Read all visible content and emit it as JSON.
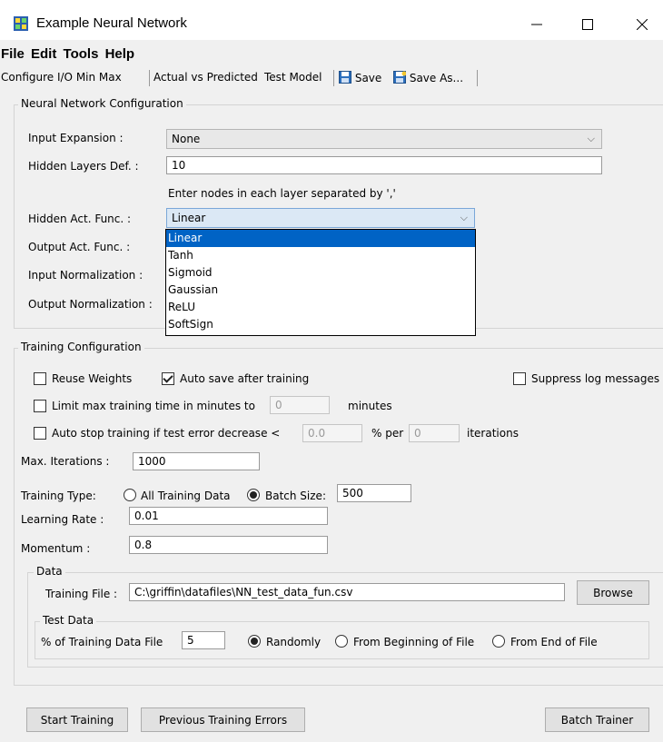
{
  "window": {
    "title": "Example Neural Network",
    "minimize_icon": "minimize-icon",
    "maximize_icon": "maximize-icon",
    "close_icon": "close-icon"
  },
  "menu": [
    "File",
    "Edit",
    "Tools",
    "Help"
  ],
  "toolbar": {
    "configure": "Configure I/O Min Max",
    "actual_vs_predicted": "Actual vs Predicted",
    "test_model": "Test Model",
    "save": "Save",
    "save_as": "Save As..."
  },
  "nn_config": {
    "title": "Neural Network Configuration",
    "input_expansion": {
      "label": "Input Expansion :",
      "value": "None"
    },
    "hidden_layers": {
      "label": "Hidden Layers Def. :",
      "value": "10",
      "hint": "Enter nodes in each layer separated by ','"
    },
    "hidden_act": {
      "label": "Hidden Act. Func. :",
      "value": "Linear",
      "options": [
        "Linear",
        "Tanh",
        "Sigmoid",
        "Gaussian",
        "ReLU",
        "SoftSign"
      ]
    },
    "output_act": {
      "label": "Output Act. Func. :"
    },
    "input_norm": {
      "label": "Input Normalization :"
    },
    "output_norm": {
      "label": "Output Normalization :"
    }
  },
  "training": {
    "title": "Training Configuration",
    "reuse_weights": {
      "label": "Reuse Weights",
      "checked": false
    },
    "auto_save": {
      "label": "Auto save after training",
      "checked": true
    },
    "suppress_log": {
      "label": "Suppress log messages",
      "checked": false
    },
    "limit_time": {
      "label": "Limit max training time in minutes to",
      "value": "0",
      "unit": "minutes",
      "checked": false
    },
    "auto_stop": {
      "label": "Auto stop training if test error decrease <",
      "value": "0.0",
      "per_label": "% per",
      "iter_value": "0",
      "iter_label": "iterations",
      "checked": false
    },
    "max_iterations": {
      "label": "Max. Iterations :",
      "value": "1000"
    },
    "training_type": {
      "label": "Training Type:",
      "all_label": "All Training Data",
      "batch_label": "Batch Size:",
      "batch_value": "500",
      "selected": "batch"
    },
    "learning_rate": {
      "label": "Learning Rate :",
      "value": "0.01"
    },
    "momentum": {
      "label": "Momentum :",
      "value": "0.8"
    },
    "data": {
      "title": "Data",
      "training_file_label": "Training File :",
      "training_file_value": "C:\\griffin\\datafiles\\NN_test_data_fun.csv",
      "browse": "Browse",
      "test_data": {
        "title": "Test Data",
        "pct_label": "% of Training Data File",
        "pct_value": "5",
        "randomly": "Randomly",
        "from_beginning": "From Beginning of File",
        "from_end": "From End of File",
        "selected": "randomly"
      }
    }
  },
  "buttons": {
    "start": "Start Training",
    "previous_errors": "Previous Training Errors",
    "batch": "Batch Trainer"
  }
}
